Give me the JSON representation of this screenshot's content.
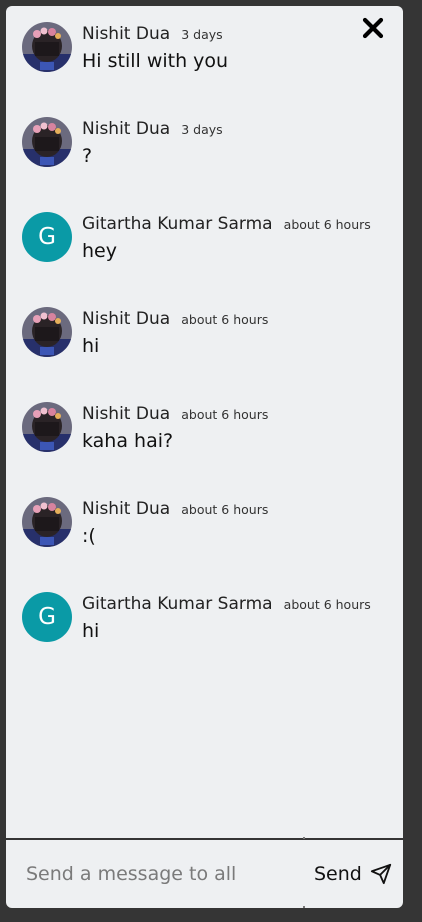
{
  "messages": [
    {
      "author": "Nishit Dua",
      "time": "3 days",
      "text": "Hi still with you",
      "avatar": "photo"
    },
    {
      "author": "Nishit Dua",
      "time": "3 days",
      "text": "?",
      "avatar": "photo"
    },
    {
      "author": "Gitartha Kumar Sarma",
      "time": "about 6 hours",
      "text": "hey",
      "avatar": "letter",
      "initial": "G"
    },
    {
      "author": "Nishit Dua",
      "time": "about 6 hours",
      "text": "hi",
      "avatar": "photo"
    },
    {
      "author": "Nishit Dua",
      "time": "about 6 hours",
      "text": "kaha hai?",
      "avatar": "photo"
    },
    {
      "author": "Nishit Dua",
      "time": "about 6 hours",
      "text": ":(",
      "avatar": "photo"
    },
    {
      "author": "Gitartha Kumar Sarma",
      "time": "about 6 hours",
      "text": "hi",
      "avatar": "letter",
      "initial": "G"
    }
  ],
  "composer": {
    "placeholder": "Send a message to all",
    "value": "",
    "send_label": "Send"
  },
  "icons": {
    "close": "close-icon",
    "send": "send-icon"
  },
  "colors": {
    "background": "#353535",
    "panel": "#eef0f2",
    "letter_avatar": "#0a9aa6"
  }
}
